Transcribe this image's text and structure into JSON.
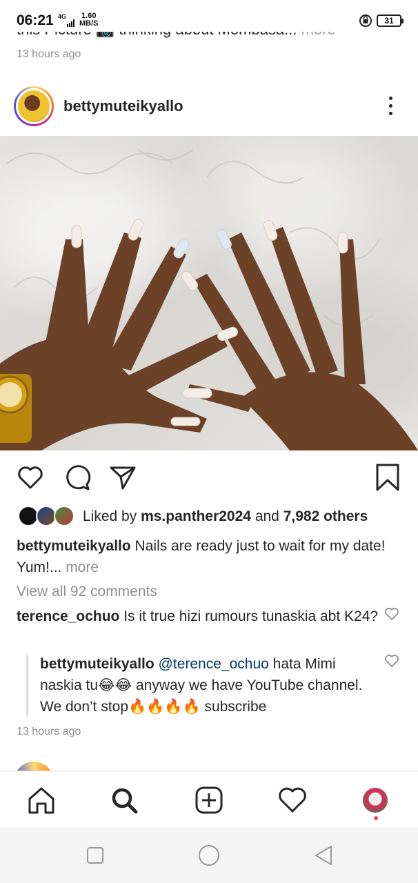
{
  "status_bar": {
    "time": "06:21",
    "network": "4G",
    "speed_value": "1.60",
    "speed_unit": "MB/S",
    "battery": "31"
  },
  "previous_post": {
    "caption_fragment": "this Picture 📷 thinking about Mombasa...",
    "more": " more",
    "timestamp": "13 hours ago"
  },
  "post": {
    "username": "bettymuteikyallo",
    "likes": {
      "prefix": "Liked by ",
      "user": "ms.panther2024",
      "middle": " and ",
      "others": "7,982 others"
    },
    "caption": {
      "user": "bettymuteikyallo",
      "text": " Nails are ready just to wait for my date! Yum!...",
      "more": " more"
    },
    "view_all_comments": "View all 92 comments",
    "comments": [
      {
        "user": "terence_ochuo",
        "text": " Is it true hizi rumours tunaskia abt K24?"
      }
    ],
    "reply": {
      "user": "bettymuteikyallo",
      "mention": " @terence_ochuo",
      "text": " hata Mimi naskia tu😂😂 anyway we have YouTube channel. We don’t stop🔥🔥🔥🔥 subscribe"
    },
    "timestamp": "13 hours ago"
  },
  "colors": {
    "text": "#262626",
    "muted": "#8e8e8e",
    "mention": "#00376b",
    "notification": "#ed4956"
  },
  "icons": {
    "post_actions": [
      "heart-icon",
      "comment-icon",
      "share-icon",
      "bookmark-icon"
    ],
    "bottom_nav": [
      "home-icon",
      "search-icon",
      "add-post-icon",
      "activity-icon",
      "profile-avatar"
    ],
    "system_nav": [
      "recents-square-icon",
      "home-circle-icon",
      "back-triangle-icon"
    ]
  }
}
